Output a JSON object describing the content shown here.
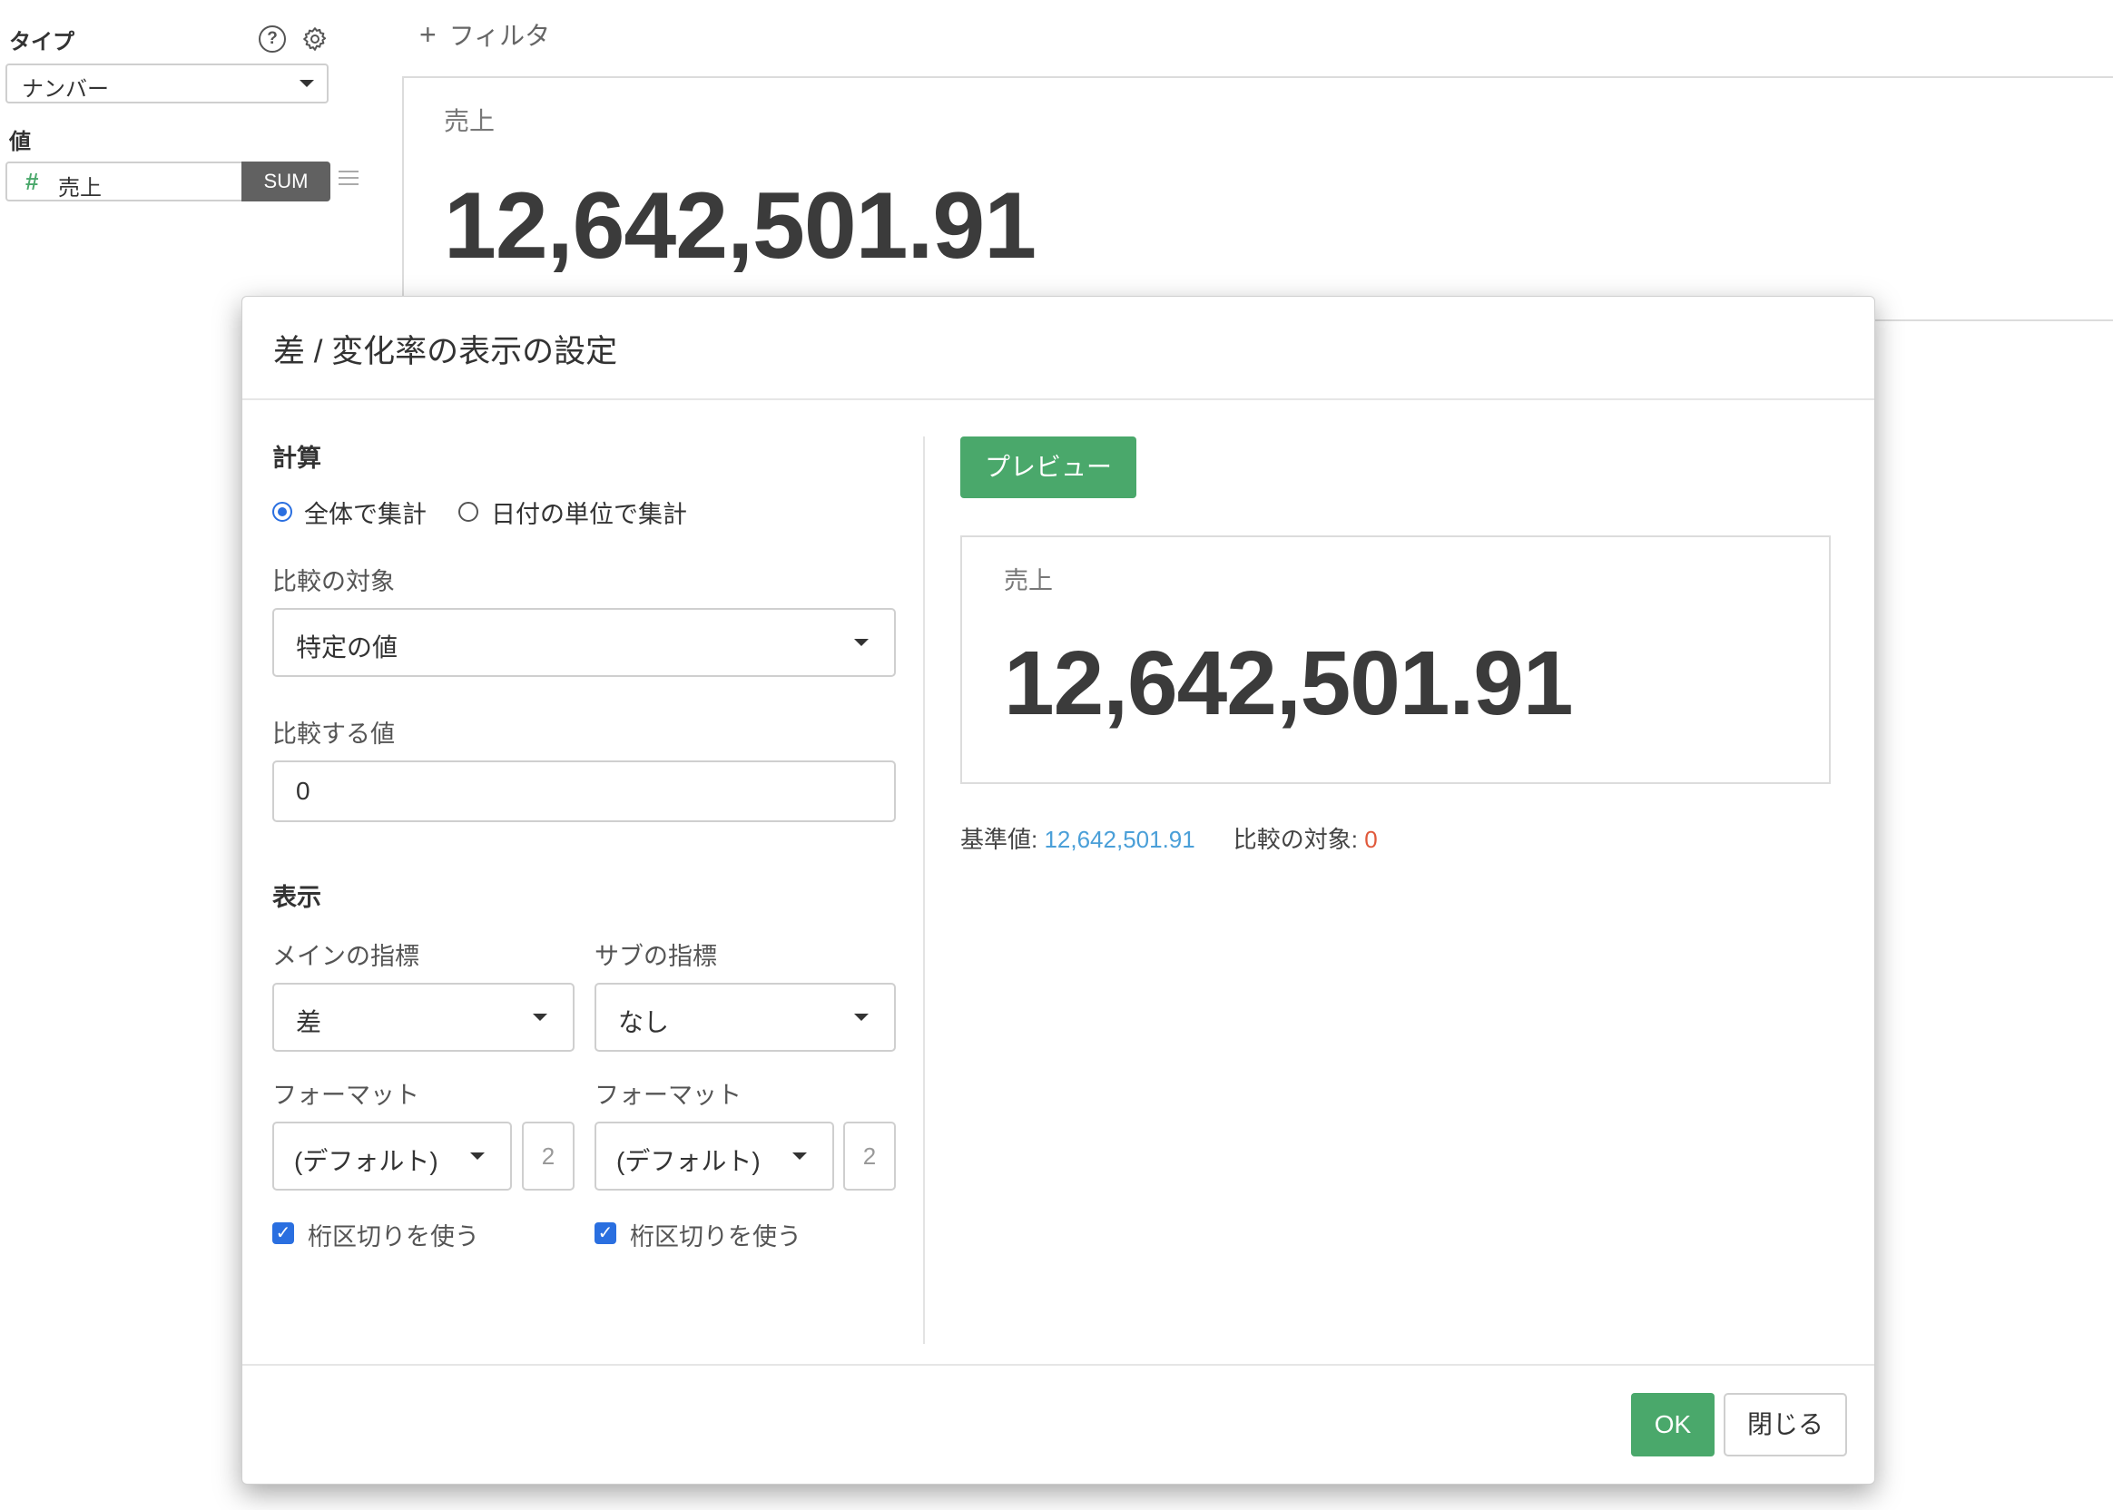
{
  "sidebar": {
    "type_label": "タイプ",
    "type_value": "ナンバー",
    "value_label": "値",
    "value_field": "売上",
    "value_field_icon": "#",
    "aggregation": "SUM"
  },
  "toolbar": {
    "add_filter_label": "フィルタ",
    "add_icon": "+"
  },
  "background_card": {
    "label": "売上",
    "value": "12,642,501.91"
  },
  "modal": {
    "title": "差 / 変化率の表示の設定",
    "calc_section": "計算",
    "radio_all": "全体で集計",
    "radio_date": "日付の単位で集計",
    "compare_target_label": "比較の対象",
    "compare_target_value": "特定の値",
    "compare_value_label": "比較する値",
    "compare_value": "0",
    "display_section": "表示",
    "main_metric_label": "メインの指標",
    "main_metric_value": "差",
    "sub_metric_label": "サブの指標",
    "sub_metric_value": "なし",
    "format_label_left": "フォーマット",
    "format_label_right": "フォーマット",
    "format_value_left": "(デフォルト)",
    "format_value_right": "(デフォルト)",
    "decimals_left": "2",
    "decimals_right": "2",
    "thousands_left": "桁区切りを使う",
    "thousands_right": "桁区切りを使う",
    "preview_button": "プレビュー",
    "preview_label": "売上",
    "preview_value": "12,642,501.91",
    "base_value_label": "基準値: ",
    "base_value": "12,642,501.91",
    "compare_target_text_label": "比較の対象: ",
    "compare_target_text_value": "0",
    "ok_button": "OK",
    "close_button": "閉じる"
  },
  "colors": {
    "accent_blue": "#2a6fe0",
    "base_value_color": "#4a9fd8",
    "compare_value_color": "#e0593b",
    "green_button": "#4aa86b"
  }
}
